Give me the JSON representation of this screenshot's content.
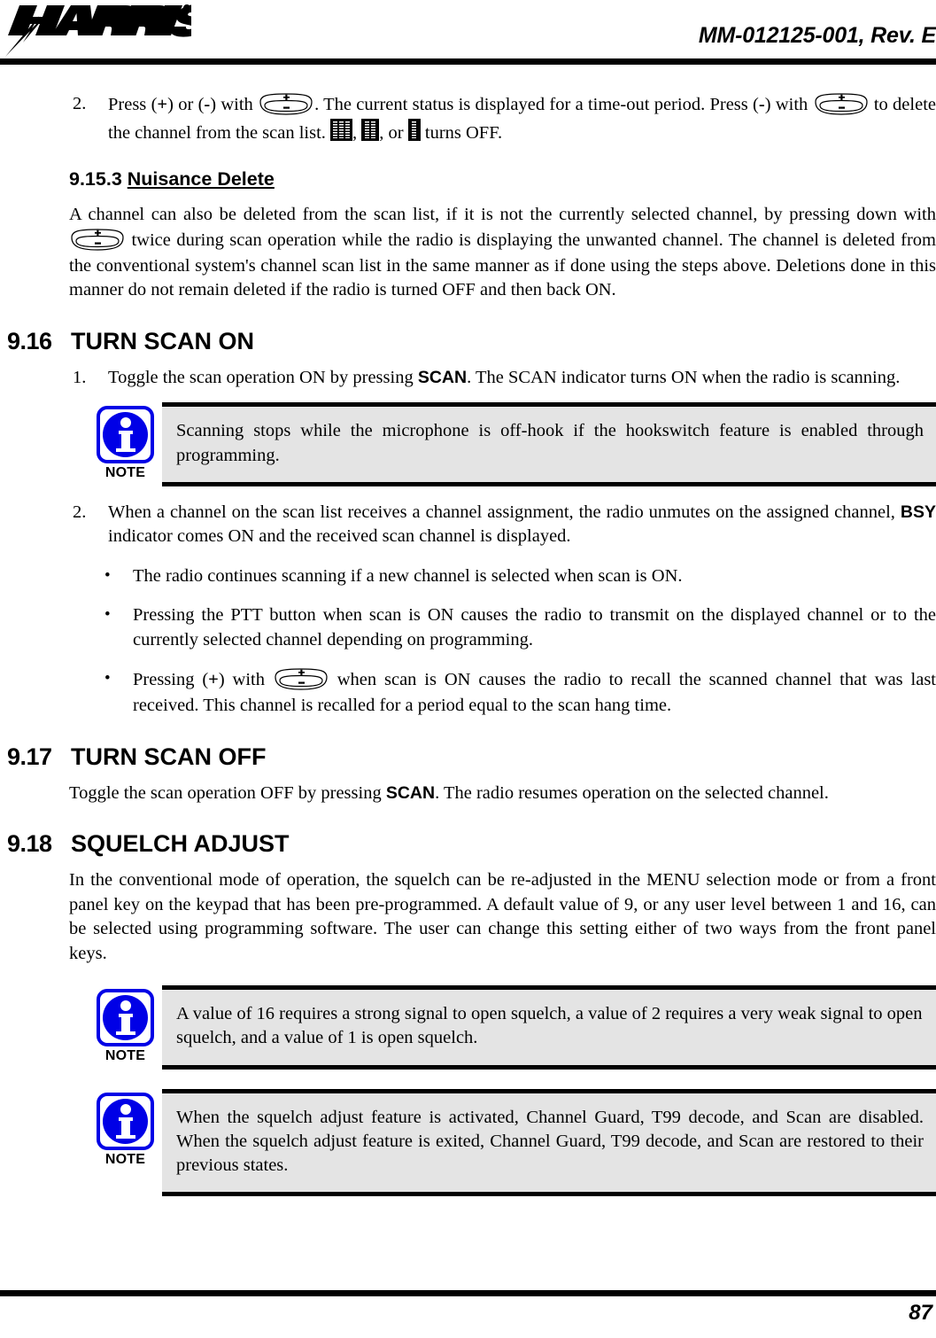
{
  "header": {
    "logo_text": "HARRIS",
    "doc_number": "MM-012125-001, Rev. E"
  },
  "footer": {
    "page_number": "87"
  },
  "content": {
    "step2_scan_delete": {
      "marker": "2.",
      "text_a": "Press (",
      "plus": "+",
      "text_b": ") or (",
      "minus": "-",
      "text_c": ") with ",
      "text_d": ". The current status is displayed for a time-out period. Press (",
      "minus2": "-",
      "text_e": ") with ",
      "text_f": " to delete the channel from the scan list. ",
      "sep1": ", ",
      "sep2": ", or ",
      "text_g": " turns OFF."
    },
    "heading_9_15_3": {
      "number": "9.15.3 ",
      "title": "Nuisance Delete"
    },
    "nuisance_para": {
      "part1": "A channel can also be deleted from the scan list, if it is not the currently selected channel, by pressing down with ",
      "part2": " twice during scan operation while the radio is displaying the unwanted channel. The channel is deleted from the conventional system's channel scan list in the same manner as if done using the steps above. Deletions done in this manner do not remain deleted if the radio is turned OFF and then back ON."
    },
    "heading_9_16": {
      "number": "9.16",
      "title": "TURN SCAN ON"
    },
    "step1_turn_scan_on": {
      "marker": "1.",
      "text_a": "Toggle the scan operation ON by pressing ",
      "bold": "SCAN",
      "text_b": ". The SCAN indicator turns ON when the radio is scanning."
    },
    "note_hookswitch": {
      "label": "NOTE",
      "text": "Scanning stops while the microphone is off-hook if the hookswitch feature is enabled through programming."
    },
    "step2_scan_assignment": {
      "marker": "2.",
      "text_a": "When a channel on the scan list receives a channel assignment, the radio unmutes on the assigned channel, ",
      "bold": "BSY",
      "text_b": " indicator comes ON and the received scan channel is displayed."
    },
    "bullets": [
      {
        "text": "The radio continues scanning if a new channel is selected when scan is ON."
      },
      {
        "text": "Pressing the PTT button when scan is ON causes the radio to transmit on the displayed channel or to the currently selected channel depending on programming."
      }
    ],
    "bullet_recall": {
      "text_a": "Pressing (",
      "plus": "+",
      "text_b": ") with ",
      "text_c": " when scan is ON causes the radio to recall the scanned channel that was last received. This channel is recalled for a period equal to the scan hang time."
    },
    "heading_9_17": {
      "number": "9.17",
      "title": "TURN SCAN OFF"
    },
    "turn_scan_off_para": {
      "text_a": "Toggle the scan operation OFF by pressing ",
      "bold": "SCAN",
      "text_b": ". The radio resumes operation on the selected channel."
    },
    "heading_9_18": {
      "number": "9.18",
      "title": "SQUELCH ADJUST"
    },
    "squelch_para": "In the conventional mode of operation, the squelch can be re-adjusted in the MENU selection mode or from a front panel key on the keypad that has been pre-programmed. A default value of 9, or any user level between 1 and 16, can be selected using programming software. The user can change this setting either of two ways from the front panel keys.",
    "note_values": {
      "label": "NOTE",
      "text": "A value of 16 requires a strong signal to open squelch, a value of 2 requires a very weak signal to open squelch, and a value of 1 is open squelch."
    },
    "note_squelch_adjust": {
      "label": "NOTE",
      "text": "When the squelch adjust feature is activated, Channel Guard, T99 decode, and Scan are disabled. When the squelch adjust feature is exited, Channel Guard, T99 decode, and Scan are restored to their previous states."
    }
  },
  "icons": {
    "rocker_plus": "+",
    "rocker_minus": "-",
    "signal_3_bars": "signal-3-bars",
    "signal_2_bars": "signal-2-bars",
    "signal_1_bar": "signal-1-bar"
  },
  "colors": {
    "note_blue": "#0000E6",
    "note_bg": "#E4E4E4",
    "rule_black": "#000000"
  }
}
